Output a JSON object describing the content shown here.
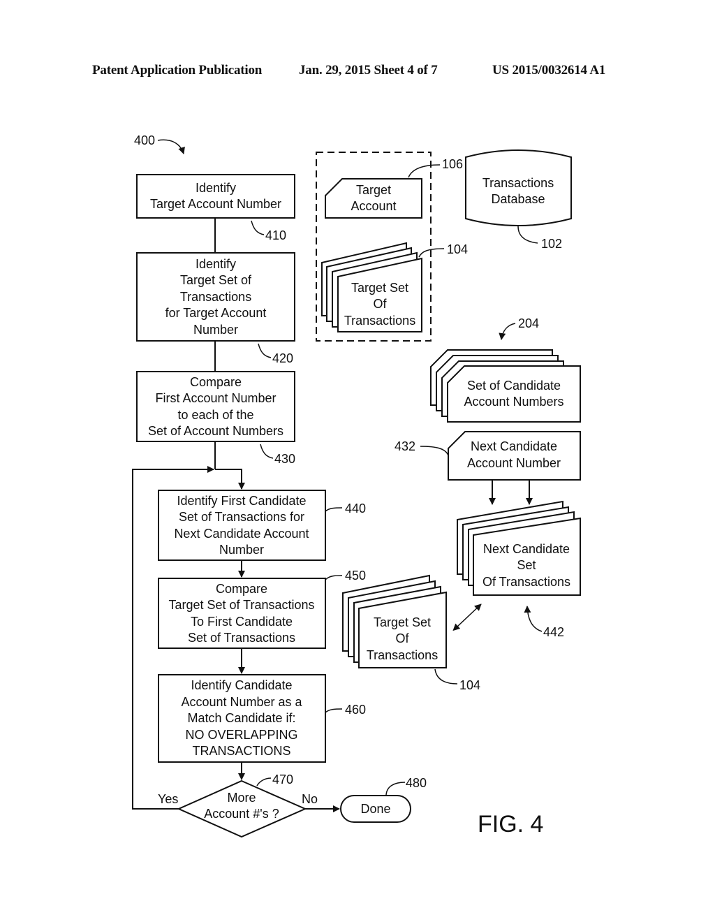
{
  "header": {
    "left": "Patent Application Publication",
    "middle": "Jan. 29, 2015  Sheet 4 of 7",
    "right": "US 2015/0032614 A1"
  },
  "figure": {
    "label": "FIG. 4",
    "ref": "400"
  },
  "steps": [
    {
      "id": "410",
      "lines": [
        "Identify",
        "Target Account Number"
      ]
    },
    {
      "id": "420",
      "lines": [
        "Identify",
        "Target Set of",
        "Transactions",
        "for Target Account",
        "Number"
      ]
    },
    {
      "id": "430",
      "lines": [
        "Compare",
        "First Account Number",
        "to each of the",
        "Set of Account Numbers"
      ]
    },
    {
      "id": "440",
      "lines": [
        "Identify First Candidate",
        "Set of Transactions for",
        "Next Candidate Account",
        "Number"
      ]
    },
    {
      "id": "450",
      "lines": [
        "Compare",
        "Target Set of Transactions",
        "To First Candidate",
        "Set of Transactions"
      ]
    },
    {
      "id": "460",
      "lines": [
        "Identify Candidate",
        "Account Number as a",
        "Match Candidate if:",
        "NO OVERLAPPING",
        "TRANSACTIONS"
      ]
    }
  ],
  "decision": {
    "id": "470",
    "lines": [
      "More",
      "Account #'s ?"
    ],
    "yes": "Yes",
    "no": "No"
  },
  "terminal": {
    "id": "480",
    "label": "Done"
  },
  "data_items": {
    "target_account": {
      "id": "106",
      "lines": [
        "Target",
        "Account"
      ]
    },
    "database": {
      "id": "102",
      "lines": [
        "Transactions",
        "Database"
      ]
    },
    "target_set_top": {
      "id": "104",
      "lines": [
        "Target Set",
        "Of",
        "Transactions"
      ]
    },
    "candidate_accounts": {
      "id": "204",
      "lines": [
        "Set of Candidate",
        "Account Numbers"
      ]
    },
    "next_candidate_account": {
      "id": "432",
      "lines": [
        "Next Candidate",
        "Account Number"
      ]
    },
    "next_candidate_set": {
      "id": "442",
      "lines": [
        "Next Candidate",
        "Set",
        "Of Transactions"
      ]
    },
    "target_set_bottom": {
      "id": "104",
      "lines": [
        "Target Set",
        "Of",
        "Transactions"
      ]
    }
  }
}
